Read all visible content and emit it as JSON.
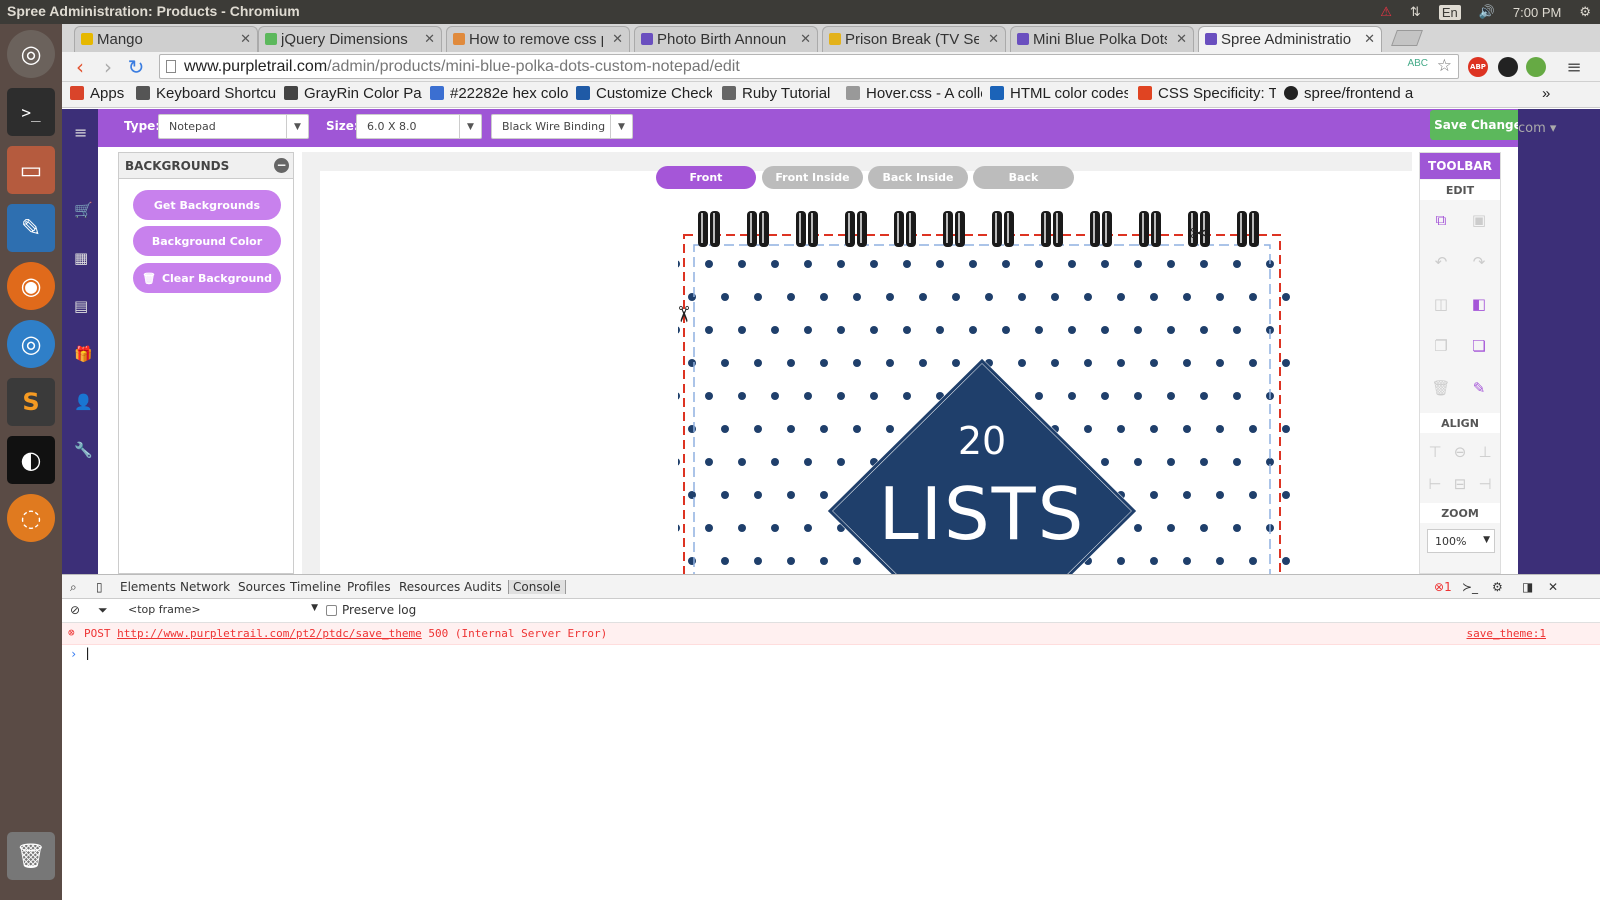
{
  "window": {
    "title": "Spree Administration: Products - Chromium",
    "lang": "En",
    "time": "7:00 PM"
  },
  "launcher": {
    "apps": [
      "ubuntu-dash",
      "terminal",
      "file-manager",
      "libreoffice-writer",
      "firefox",
      "chromium",
      "sublime-text",
      "inkscape",
      "blender",
      "trash"
    ]
  },
  "tabs": [
    {
      "label": "Mango",
      "color": "#e6b800"
    },
    {
      "label": "jQuery Dimensions",
      "color": "#5cb85c"
    },
    {
      "label": "How to remove css p",
      "color": "#e08a3c"
    },
    {
      "label": "Photo Birth Announ",
      "color": "#6a4fbf"
    },
    {
      "label": "Prison Break (TV Ser",
      "color": "#e3b21b"
    },
    {
      "label": "Mini Blue Polka Dots",
      "color": "#6a4fbf"
    },
    {
      "label": "Spree Administratio",
      "color": "#6a4fbf"
    }
  ],
  "omnibox": {
    "host": "www.purpletrail.com",
    "path": "/admin/products/mini-blue-polka-dots-custom-notepad/edit"
  },
  "bookmarks": [
    {
      "label": "Apps",
      "color": "#d9442a"
    },
    {
      "label": "Keyboard Shortcu",
      "color": "#555"
    },
    {
      "label": "GrayRin Color Pal",
      "color": "#444"
    },
    {
      "label": "#22282e hex colo",
      "color": "#3b6fd1"
    },
    {
      "label": "Customize Check",
      "color": "#1f5aa6"
    },
    {
      "label": "Ruby Tutorial",
      "color": "#666"
    },
    {
      "label": "Hover.css - A colle",
      "color": "#999"
    },
    {
      "label": "HTML color codes",
      "color": "#1b63b8"
    },
    {
      "label": "CSS Specificity: Th",
      "color": "#e04422"
    },
    {
      "label": "spree/frontend a",
      "color": "#222"
    }
  ],
  "editor": {
    "type_label": "Type:",
    "type_value": "Notepad",
    "size_label": "Size:",
    "size_value": "6.0 X 8.0",
    "binding_value": "Black Wire Binding",
    "save_label": "Save Changes",
    "user_text": "com"
  },
  "backgrounds": {
    "title": "BACKGROUNDS",
    "get": "Get Backgrounds",
    "color": "Background Color",
    "clear": "Clear Background"
  },
  "view_tabs": [
    "Front",
    "Front Inside",
    "Back Inside",
    "Back"
  ],
  "design": {
    "top": "20",
    "main": "LISTS",
    "bg_color": "#1f3f6b"
  },
  "toolbar": {
    "title": "TOOLBAR",
    "edit": "EDIT",
    "align": "ALIGN",
    "zoom": "ZOOM",
    "zoom_value": "100%"
  },
  "devtools": {
    "tabs": [
      "Elements",
      "Network",
      "Sources",
      "Timeline",
      "Profiles",
      "Resources",
      "Audits",
      "Console"
    ],
    "error_count": "1",
    "frame": "<top frame>",
    "preserve_log": "Preserve log",
    "error": {
      "method": "POST",
      "url": "http://www.purpletrail.com/pt2/ptdc/save_theme",
      "status": "500 (Internal Server Error)",
      "source": "save_theme:1"
    }
  }
}
